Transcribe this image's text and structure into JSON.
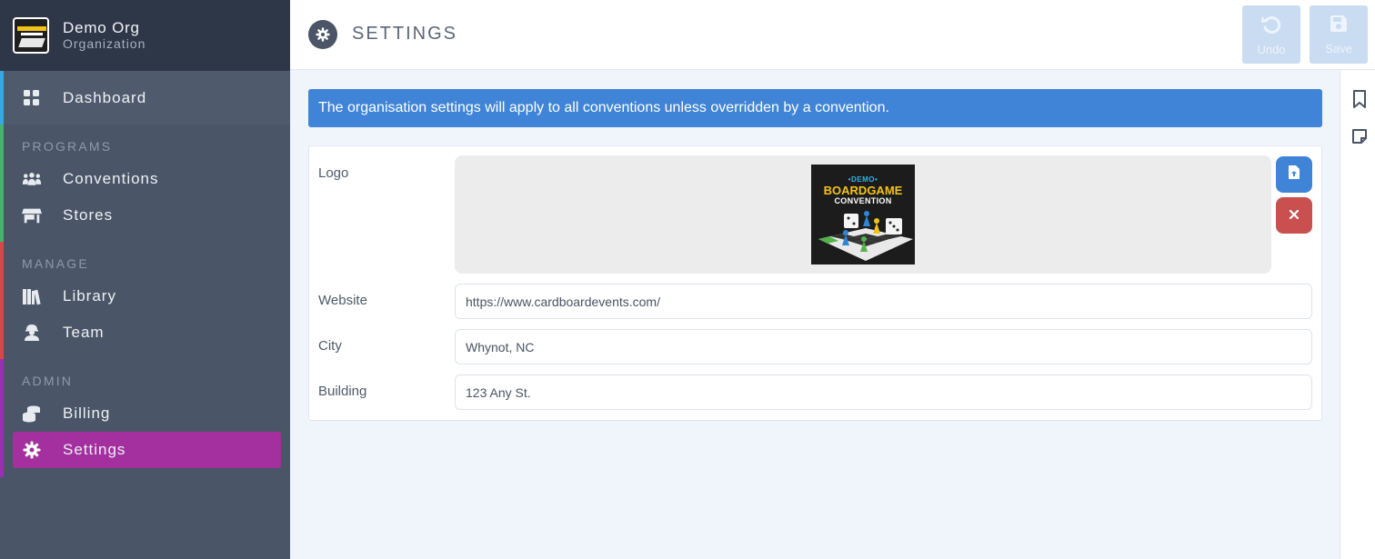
{
  "org": {
    "name": "Demo Org",
    "type": "Organization"
  },
  "sidebar": {
    "dashboard": {
      "label": "Dashboard",
      "icon": "grid-icon"
    },
    "sections": [
      {
        "label": "PROGRAMS",
        "color": "#45b36b",
        "items": [
          {
            "label": "Conventions",
            "icon": "people-group-icon"
          },
          {
            "label": "Stores",
            "icon": "store-icon"
          }
        ]
      },
      {
        "label": "MANAGE",
        "color": "#d64848",
        "items": [
          {
            "label": "Library",
            "icon": "books-icon"
          },
          {
            "label": "Team",
            "icon": "worker-icon"
          }
        ]
      },
      {
        "label": "ADMIN",
        "color": "#9b2fb2",
        "items": [
          {
            "label": "Billing",
            "icon": "coins-icon"
          },
          {
            "label": "Settings",
            "icon": "gear-icon",
            "active": true
          }
        ]
      }
    ]
  },
  "header": {
    "title": "SETTINGS",
    "undo_label": "Undo",
    "save_label": "Save"
  },
  "banner": "The organisation settings will apply to all conventions unless overridden by a convention.",
  "form": {
    "logo_label": "Logo",
    "logo_text": {
      "demo": "•DEMO•",
      "title": "BOARDGAME",
      "subtitle": "CONVENTION"
    },
    "website_label": "Website",
    "website_value": "https://www.cardboardevents.com/",
    "city_label": "City",
    "city_value": "Whynot, NC",
    "building_label": "Building",
    "building_value": "123 Any St."
  },
  "colors": {
    "accent": "#3f84d6",
    "active": "#a3309e",
    "danger": "#c9504f",
    "sidebar": "#4a5668"
  }
}
